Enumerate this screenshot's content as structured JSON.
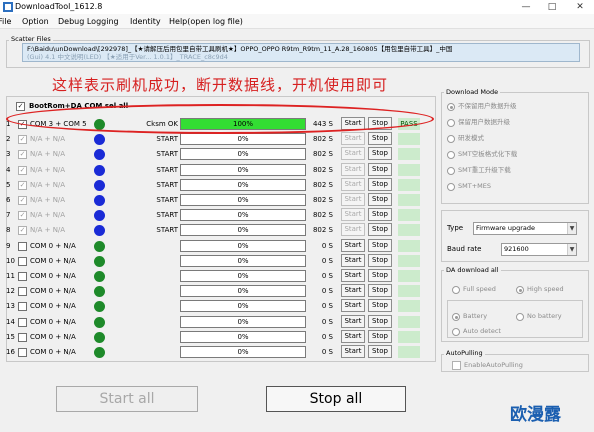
{
  "window": {
    "title": "DownloadTool_1612.8",
    "controls": {
      "minimize": "—",
      "maximize": "□",
      "close": "✕"
    }
  },
  "menu": {
    "file": "File",
    "option": "Option",
    "debug_logging": "Debug Logging",
    "identity": "Identity",
    "help": "Help(open log file)"
  },
  "scatter": {
    "legend": "Scatter Files",
    "path": "F:\\Baidu\\unDownload\\[292978]_【★请解压后用包里自带工具刷机★】OPPO_OPPO R9tm_R9tm_11_A.28_160805【用包里自带工具】_中国",
    "path_line2": "(Gui) 4.1 中文说明(LED) 【★适用于Ver... 1.0.1】_TRACE_c8c9d4"
  },
  "annotation": "这样表示刷机成功，断开数据线，开机使用即可",
  "bootrom": {
    "label": "BootRom+DA COM sel all"
  },
  "rows": [
    {
      "num": "1",
      "checked": true,
      "dim": false,
      "port": "COM 3 + COM 5",
      "dot": "#1e8a2a",
      "state": "Cksm OK",
      "progress": 100,
      "progress_text": "100%",
      "time": "443 S",
      "start": "Start",
      "start_enabled": true,
      "stop": "Stop",
      "result": "PASS"
    },
    {
      "num": "2",
      "checked": true,
      "dim": true,
      "port": "N/A + N/A",
      "dot": "#1a2bd6",
      "state": "START",
      "progress": 0,
      "progress_text": "0%",
      "time": "802 S",
      "start": "Start",
      "start_enabled": false,
      "stop": "Stop",
      "result": ""
    },
    {
      "num": "3",
      "checked": true,
      "dim": true,
      "port": "N/A + N/A",
      "dot": "#1a2bd6",
      "state": "START",
      "progress": 0,
      "progress_text": "0%",
      "time": "802 S",
      "start": "Start",
      "start_enabled": false,
      "stop": "Stop",
      "result": ""
    },
    {
      "num": "4",
      "checked": true,
      "dim": true,
      "port": "N/A + N/A",
      "dot": "#1a2bd6",
      "state": "START",
      "progress": 0,
      "progress_text": "0%",
      "time": "802 S",
      "start": "Start",
      "start_enabled": false,
      "stop": "Stop",
      "result": ""
    },
    {
      "num": "5",
      "checked": true,
      "dim": true,
      "port": "N/A + N/A",
      "dot": "#1a2bd6",
      "state": "START",
      "progress": 0,
      "progress_text": "0%",
      "time": "802 S",
      "start": "Start",
      "start_enabled": false,
      "stop": "Stop",
      "result": ""
    },
    {
      "num": "6",
      "checked": true,
      "dim": true,
      "port": "N/A + N/A",
      "dot": "#1a2bd6",
      "state": "START",
      "progress": 0,
      "progress_text": "0%",
      "time": "802 S",
      "start": "Start",
      "start_enabled": false,
      "stop": "Stop",
      "result": ""
    },
    {
      "num": "7",
      "checked": true,
      "dim": true,
      "port": "N/A + N/A",
      "dot": "#1a2bd6",
      "state": "START",
      "progress": 0,
      "progress_text": "0%",
      "time": "802 S",
      "start": "Start",
      "start_enabled": false,
      "stop": "Stop",
      "result": ""
    },
    {
      "num": "8",
      "checked": true,
      "dim": true,
      "port": "N/A + N/A",
      "dot": "#1a2bd6",
      "state": "START",
      "progress": 0,
      "progress_text": "0%",
      "time": "802 S",
      "start": "Start",
      "start_enabled": false,
      "stop": "Stop",
      "result": ""
    },
    {
      "num": "9",
      "checked": false,
      "dim": false,
      "port": "COM 0 + N/A",
      "dot": "#1e8a2a",
      "state": "",
      "progress": 0,
      "progress_text": "0%",
      "time": "0 S",
      "start": "Start",
      "start_enabled": true,
      "stop": "Stop",
      "result": ""
    },
    {
      "num": "10",
      "checked": false,
      "dim": false,
      "port": "COM 0 + N/A",
      "dot": "#1e8a2a",
      "state": "",
      "progress": 0,
      "progress_text": "0%",
      "time": "0 S",
      "start": "Start",
      "start_enabled": true,
      "stop": "Stop",
      "result": ""
    },
    {
      "num": "11",
      "checked": false,
      "dim": false,
      "port": "COM 0 + N/A",
      "dot": "#1e8a2a",
      "state": "",
      "progress": 0,
      "progress_text": "0%",
      "time": "0 S",
      "start": "Start",
      "start_enabled": true,
      "stop": "Stop",
      "result": ""
    },
    {
      "num": "12",
      "checked": false,
      "dim": false,
      "port": "COM 0 + N/A",
      "dot": "#1e8a2a",
      "state": "",
      "progress": 0,
      "progress_text": "0%",
      "time": "0 S",
      "start": "Start",
      "start_enabled": true,
      "stop": "Stop",
      "result": ""
    },
    {
      "num": "13",
      "checked": false,
      "dim": false,
      "port": "COM 0 + N/A",
      "dot": "#1e8a2a",
      "state": "",
      "progress": 0,
      "progress_text": "0%",
      "time": "0 S",
      "start": "Start",
      "start_enabled": true,
      "stop": "Stop",
      "result": ""
    },
    {
      "num": "14",
      "checked": false,
      "dim": false,
      "port": "COM 0 + N/A",
      "dot": "#1e8a2a",
      "state": "",
      "progress": 0,
      "progress_text": "0%",
      "time": "0 S",
      "start": "Start",
      "start_enabled": true,
      "stop": "Stop",
      "result": ""
    },
    {
      "num": "15",
      "checked": false,
      "dim": false,
      "port": "COM 0 + N/A",
      "dot": "#1e8a2a",
      "state": "",
      "progress": 0,
      "progress_text": "0%",
      "time": "0 S",
      "start": "Start",
      "start_enabled": true,
      "stop": "Stop",
      "result": ""
    },
    {
      "num": "16",
      "checked": false,
      "dim": false,
      "port": "COM 0 + N/A",
      "dot": "#1e8a2a",
      "state": "",
      "progress": 0,
      "progress_text": "0%",
      "time": "0 S",
      "start": "Start",
      "start_enabled": true,
      "stop": "Stop",
      "result": ""
    }
  ],
  "download_mode": {
    "legend": "Download Mode",
    "options": [
      {
        "label": "不保留用户数据升级",
        "selected": true
      },
      {
        "label": "保留用户数据升级",
        "selected": false
      },
      {
        "label": "研发模式",
        "selected": false
      },
      {
        "label": "SMT空板格式化下载",
        "selected": false
      },
      {
        "label": "SMT重工升级下载",
        "selected": false
      },
      {
        "label": "SMT+MES",
        "selected": false
      }
    ]
  },
  "type": {
    "label": "Type",
    "value": "Firmware upgrade"
  },
  "baud": {
    "label": "Baud rate",
    "value": "921600"
  },
  "da_download": {
    "legend": "DA download all",
    "full_speed": "Full speed",
    "high_speed": "High speed",
    "battery": "Battery",
    "no_battery": "No battery",
    "auto_detect": "Auto detect"
  },
  "autopulling": {
    "legend": "AutoPulling",
    "checkbox": "EnableAutoPulling"
  },
  "buttons": {
    "start_all": "Start all",
    "stop_all": "Stop all"
  },
  "watermark": "欧漫露",
  "colors": {
    "pass_bg": "#ccebcc",
    "progress_fill": "#33dd33",
    "annotation": "#d62020",
    "highlight_oval": "#d22222"
  }
}
